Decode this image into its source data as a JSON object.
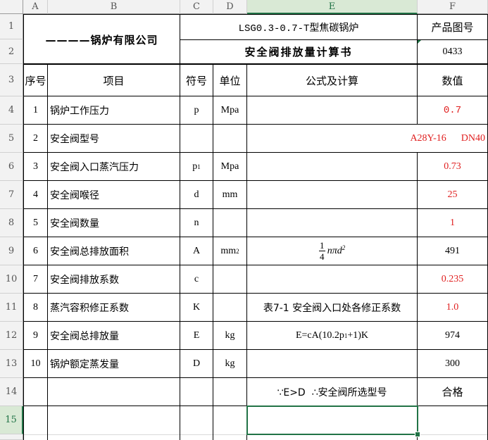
{
  "columns": [
    "A",
    "B",
    "C",
    "D",
    "E",
    "F"
  ],
  "rows": [
    "1",
    "2",
    "3",
    "4",
    "5",
    "6",
    "7",
    "8",
    "9",
    "10",
    "11",
    "12",
    "13",
    "14",
    "15"
  ],
  "selected": {
    "column": "E",
    "row": "15"
  },
  "company": "————锅炉有限公司",
  "model_title": "LSG0.3-0.7-T型焦碳锅炉",
  "doc_title": "安全阀排放量计算书",
  "drawing_no_label": "产品图号",
  "drawing_no": "0433",
  "headers": {
    "no": "序号",
    "item": "项目",
    "symbol": "符号",
    "unit": "单位",
    "formula": "公式及计算",
    "value": "数值"
  },
  "items": [
    {
      "no": "1",
      "item": "锅炉工作压力",
      "symbol": "p",
      "unit": "Mpa",
      "formula": "",
      "value": "0.7"
    },
    {
      "no": "2",
      "item": "安全阀型号",
      "symbol": "",
      "unit": "",
      "formula": "",
      "value": "A28Y-16      DN40"
    },
    {
      "no": "3",
      "item": "安全阀入口蒸汽压力",
      "symbol": "p",
      "symbol_sub": "1",
      "unit": "Mpa",
      "formula": "",
      "value": "0.73"
    },
    {
      "no": "4",
      "item": "安全阀喉径",
      "symbol": "d",
      "unit": "mm",
      "formula": "",
      "value": "25"
    },
    {
      "no": "5",
      "item": "安全阀数量",
      "symbol": "n",
      "unit": "",
      "formula": "",
      "value": "1"
    },
    {
      "no": "6",
      "item": "安全阀总排放面积",
      "symbol": "A",
      "unit": "mm",
      "unit_sup": "2",
      "formula_num": "1",
      "formula_den": "4",
      "formula": "nπd",
      "formula_sup": "2",
      "value": "491"
    },
    {
      "no": "7",
      "item": "安全阀排放系数",
      "symbol": "c",
      "unit": "",
      "formula": "",
      "value": "0.235"
    },
    {
      "no": "8",
      "item": "蒸汽容积修正系数",
      "symbol": "K",
      "unit": "",
      "formula": "表7-1 安全阀入口处各修正系数",
      "value": "1.0"
    },
    {
      "no": "9",
      "item": "安全阀总排放量",
      "symbol": "E",
      "unit": "kg",
      "formula": "E=cA(10.2p",
      "formula_sub": "1",
      "formula_tail": "+1)K",
      "value": "974"
    },
    {
      "no": "10",
      "item": "锅炉额定蒸发量",
      "symbol": "D",
      "unit": "kg",
      "formula": "",
      "value": "300"
    }
  ],
  "conclusion": {
    "formula": "∵E>D  ∴安全阀所选型号",
    "value": "合格"
  },
  "colors": {
    "accent": "#217346",
    "red_value": "#e02020"
  }
}
